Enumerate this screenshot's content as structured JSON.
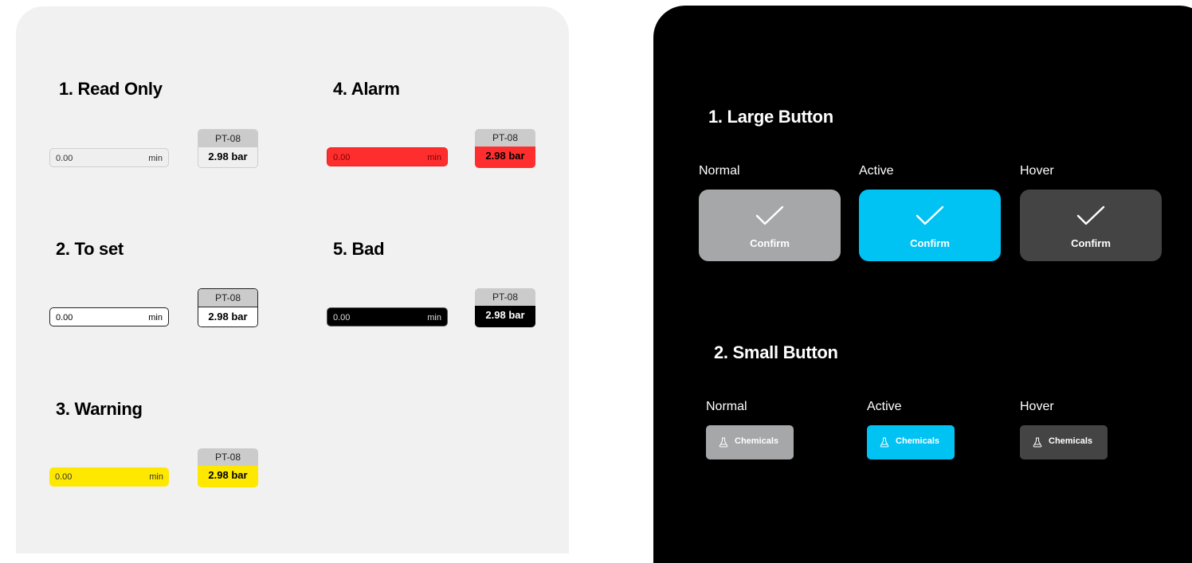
{
  "left_panel": {
    "sections": [
      {
        "key": "readonly",
        "title": "1. Read Only"
      },
      {
        "key": "toset",
        "title": "2. To set"
      },
      {
        "key": "warning",
        "title": "3. Warning"
      },
      {
        "key": "alarm",
        "title": "4. Alarm"
      },
      {
        "key": "bad",
        "title": "5. Bad"
      }
    ],
    "field": {
      "value": "0.00",
      "unit": "min"
    },
    "tag": {
      "id": "PT-08",
      "value": "2.98 bar"
    },
    "colors": {
      "warning": "#ffe800",
      "alarm": "#ff2e2e",
      "bad": "#000000",
      "readonly": "#efefef"
    }
  },
  "right_panel": {
    "large": {
      "title": "1. Large Button",
      "states": [
        "Normal",
        "Active",
        "Hover"
      ],
      "label": "Confirm",
      "icon": "checkmark-icon"
    },
    "small": {
      "title": "2. Small Button",
      "states": [
        "Normal",
        "Active",
        "Hover"
      ],
      "label": "Chemicals",
      "icon": "flask-icon"
    },
    "colors": {
      "normal": "#a5a7a8",
      "active": "#00c2f3",
      "hover": "#444444"
    }
  }
}
